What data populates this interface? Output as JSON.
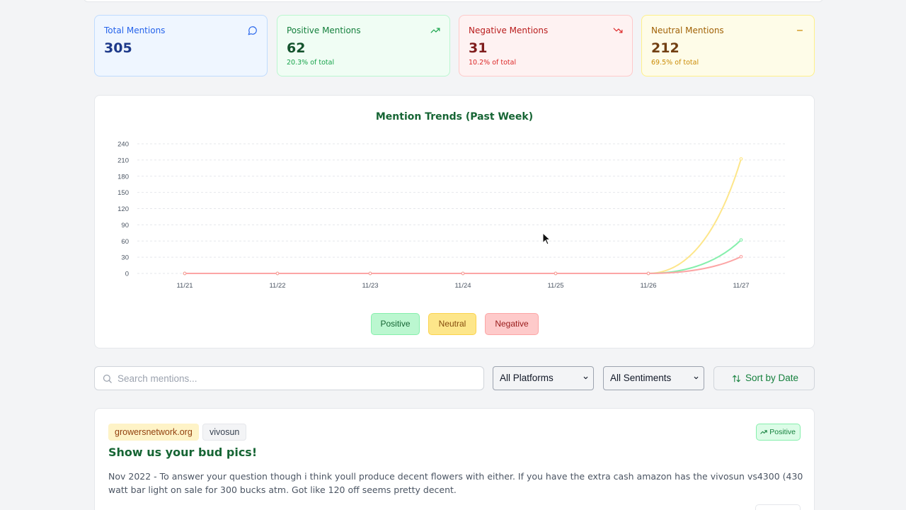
{
  "stats": {
    "total": {
      "label": "Total Mentions",
      "value": "305",
      "icon": "message-circle-icon",
      "color": "#2563eb"
    },
    "positive": {
      "label": "Positive Mentions",
      "value": "62",
      "sub": "20.3% of total",
      "icon": "trending-up-icon",
      "color": "#16a34a"
    },
    "negative": {
      "label": "Negative Mentions",
      "value": "31",
      "sub": "10.2% of total",
      "icon": "trending-down-icon",
      "color": "#dc2626"
    },
    "neutral": {
      "label": "Neutral Mentions",
      "value": "212",
      "sub": "69.5% of total",
      "icon": "minus-icon",
      "color": "#ca8a04"
    }
  },
  "chart_data": {
    "type": "line",
    "title": "Mention Trends (Past Week)",
    "xlabel": "",
    "ylabel": "",
    "categories": [
      "11/21",
      "11/22",
      "11/23",
      "11/24",
      "11/25",
      "11/26",
      "11/27"
    ],
    "ylim": [
      0,
      240
    ],
    "yticks": [
      0,
      30,
      60,
      90,
      120,
      150,
      180,
      210,
      240
    ],
    "grid": true,
    "series": [
      {
        "name": "Positive",
        "values": [
          0,
          0,
          0,
          0,
          0,
          0,
          62
        ],
        "color": "#86efac"
      },
      {
        "name": "Neutral",
        "values": [
          0,
          0,
          0,
          0,
          0,
          0,
          212
        ],
        "color": "#fde68a"
      },
      {
        "name": "Negative",
        "values": [
          0,
          0,
          0,
          0,
          0,
          0,
          31
        ],
        "color": "#fca5a5"
      }
    ]
  },
  "legend": {
    "positive": "Positive",
    "neutral": "Neutral",
    "negative": "Negative"
  },
  "filters": {
    "search_placeholder": "Search mentions...",
    "platform": "All Platforms",
    "sentiment": "All Sentiments",
    "sort_label": "Sort by Date"
  },
  "mention": {
    "site": "growersnetwork.org",
    "brand": "vivosun",
    "sentiment": "Positive",
    "title": "Show us your bud pics!",
    "body": "Nov 2022 - To answer your question though i think youll produce decent flowers with either. If you have the extra cash amazon has the vivosun vs4300 (430 watt bar light on sale for 300 bucks atm. Got like 120 off seems pretty decent."
  }
}
